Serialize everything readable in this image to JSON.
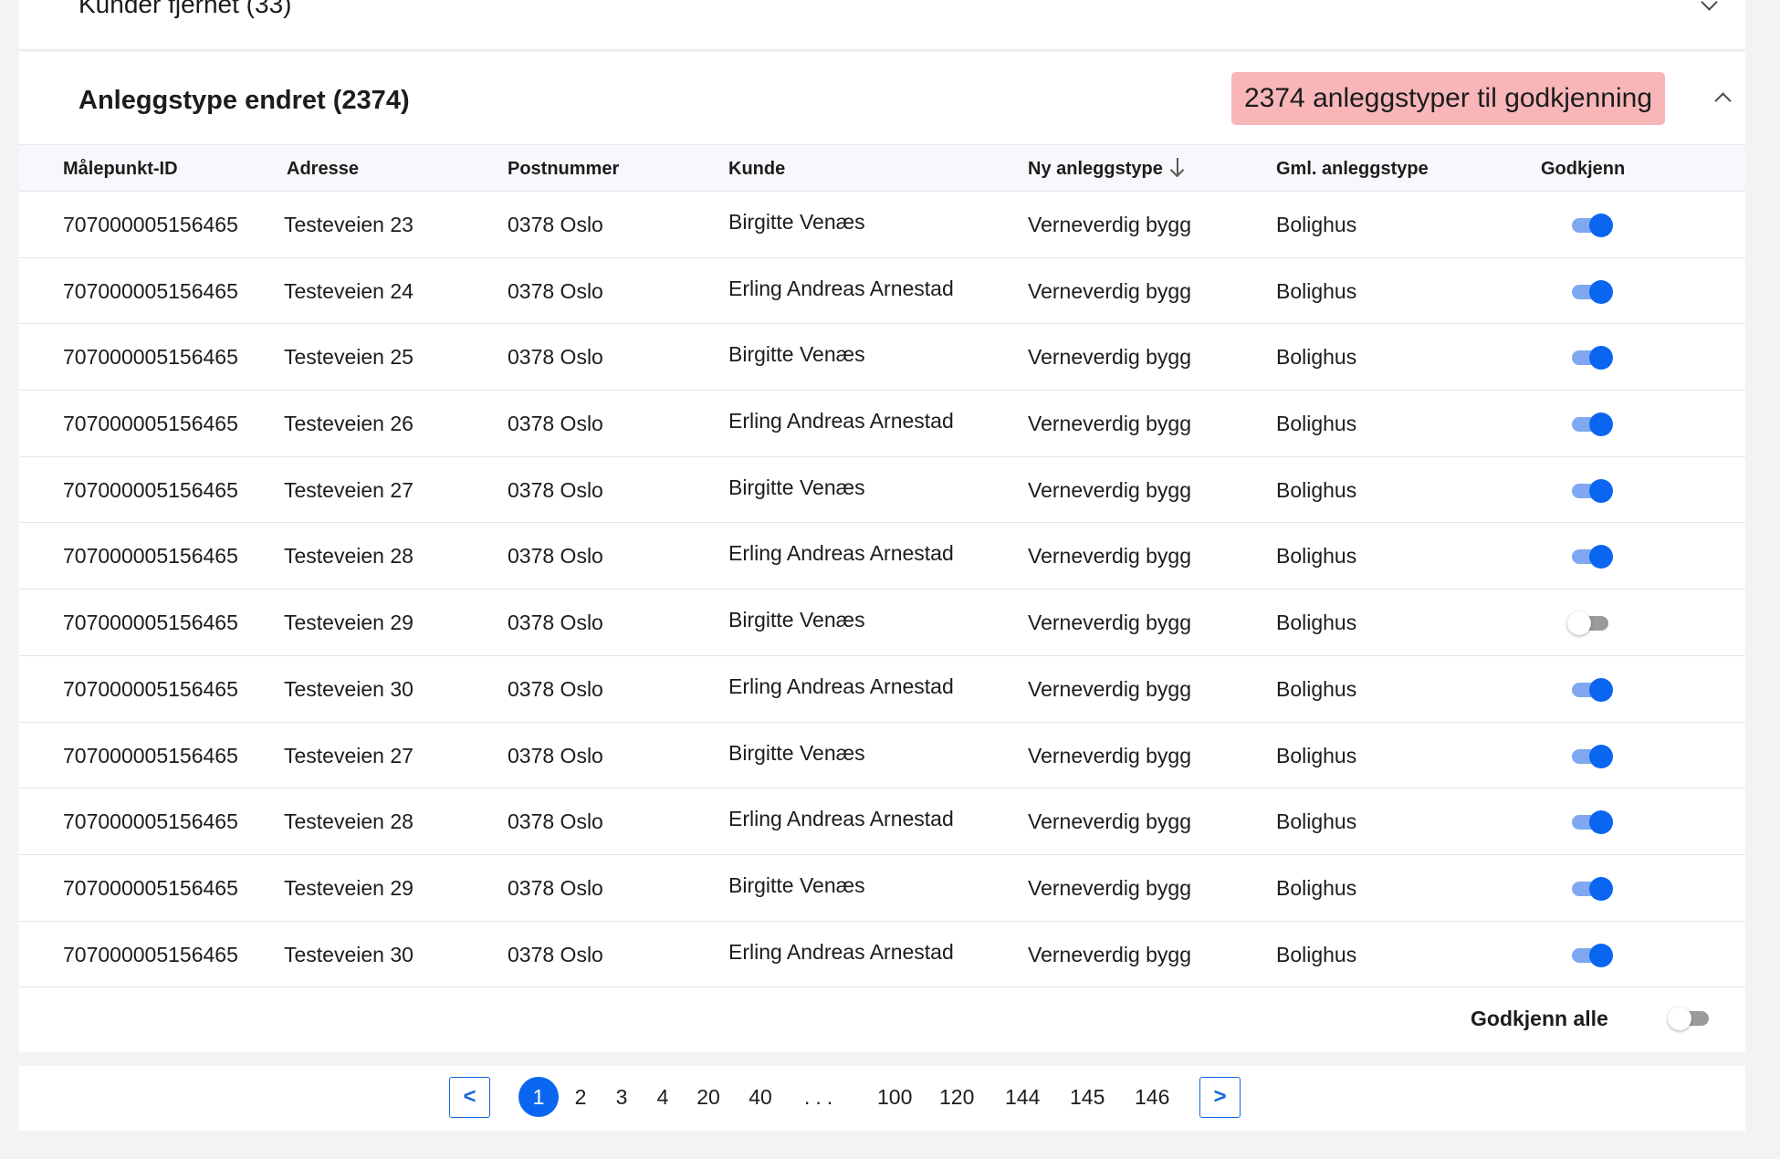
{
  "collapsed_section": {
    "title": "Kunder fjernet (33)"
  },
  "section": {
    "title": "Anleggstype endret (2374)",
    "badge": "2374 anleggstyper til godkjenning",
    "badge_color": "#f8b6b9"
  },
  "table": {
    "headers": {
      "id": "Målepunkt-ID",
      "address": "Adresse",
      "postal": "Postnummer",
      "customer": "Kunde",
      "new_type": "Ny anleggstype",
      "old_type": "Gml. anleggstype",
      "approve": "Godkjenn"
    },
    "sort_column": "new_type",
    "sort_direction": "descending",
    "rows": [
      {
        "id": "707000005156465",
        "address": "Testeveien 23",
        "postal": "0378 Oslo",
        "customer": "Birgitte Venæs",
        "new_type": "Verneverdig bygg",
        "old_type": "Bolighus",
        "approved": true
      },
      {
        "id": "707000005156465",
        "address": "Testeveien 24",
        "postal": "0378 Oslo",
        "customer": "Erling Andreas Arnestad",
        "new_type": "Verneverdig bygg",
        "old_type": "Bolighus",
        "approved": true
      },
      {
        "id": "707000005156465",
        "address": "Testeveien 25",
        "postal": "0378 Oslo",
        "customer": "Birgitte Venæs",
        "new_type": "Verneverdig bygg",
        "old_type": "Bolighus",
        "approved": true
      },
      {
        "id": "707000005156465",
        "address": "Testeveien 26",
        "postal": "0378 Oslo",
        "customer": "Erling Andreas Arnestad",
        "new_type": "Verneverdig bygg",
        "old_type": "Bolighus",
        "approved": true
      },
      {
        "id": "707000005156465",
        "address": "Testeveien 27",
        "postal": "0378 Oslo",
        "customer": "Birgitte Venæs",
        "new_type": "Verneverdig bygg",
        "old_type": "Bolighus",
        "approved": true
      },
      {
        "id": "707000005156465",
        "address": "Testeveien 28",
        "postal": "0378 Oslo",
        "customer": "Erling Andreas Arnestad",
        "new_type": "Verneverdig bygg",
        "old_type": "Bolighus",
        "approved": true
      },
      {
        "id": "707000005156465",
        "address": "Testeveien 29",
        "postal": "0378 Oslo",
        "customer": "Birgitte Venæs",
        "new_type": "Verneverdig bygg",
        "old_type": "Bolighus",
        "approved": false
      },
      {
        "id": "707000005156465",
        "address": "Testeveien 30",
        "postal": "0378 Oslo",
        "customer": "Erling Andreas Arnestad",
        "new_type": "Verneverdig bygg",
        "old_type": "Bolighus",
        "approved": true
      },
      {
        "id": "707000005156465",
        "address": "Testeveien 27",
        "postal": "0378 Oslo",
        "customer": "Birgitte Venæs",
        "new_type": "Verneverdig bygg",
        "old_type": "Bolighus",
        "approved": true
      },
      {
        "id": "707000005156465",
        "address": "Testeveien 28",
        "postal": "0378 Oslo",
        "customer": "Erling Andreas Arnestad",
        "new_type": "Verneverdig bygg",
        "old_type": "Bolighus",
        "approved": true
      },
      {
        "id": "707000005156465",
        "address": "Testeveien 29",
        "postal": "0378 Oslo",
        "customer": "Birgitte Venæs",
        "new_type": "Verneverdig bygg",
        "old_type": "Bolighus",
        "approved": true
      },
      {
        "id": "707000005156465",
        "address": "Testeveien 30",
        "postal": "0378 Oslo",
        "customer": "Erling Andreas Arnestad",
        "new_type": "Verneverdig bygg",
        "old_type": "Bolighus",
        "approved": true
      }
    ]
  },
  "approve_all": {
    "label": "Godkjenn alle",
    "enabled": false
  },
  "pagination": {
    "prev_label": "<",
    "next_label": ">",
    "current": "1",
    "pages": [
      "1",
      "2",
      "3",
      "4",
      "20",
      "40",
      "...",
      "100",
      "120",
      "144",
      "145",
      "146"
    ]
  },
  "colors": {
    "accent": "#0a66f0",
    "toggle_track_on": "#7fa8f0",
    "toggle_track_off": "#9a9a9a",
    "pager_border": "#1668dc"
  },
  "icons": {
    "collapsed_chevron": "chevron-down-icon",
    "expanded_chevron": "chevron-up-icon",
    "sort": "arrow-down-icon"
  }
}
